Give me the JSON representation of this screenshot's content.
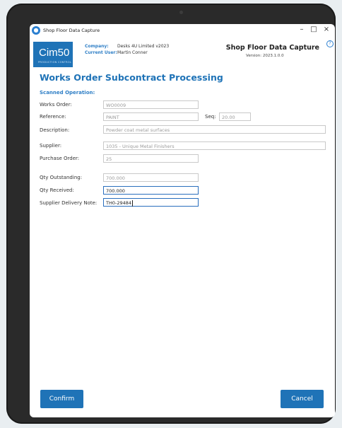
{
  "window": {
    "title": "Shop Floor Data Capture",
    "controls": {
      "minimize": "–",
      "maximize": "□",
      "close": "×"
    }
  },
  "header": {
    "logo_text": "Cim50",
    "logo_sub": "PRODUCTION CONTROL",
    "company_label": "Company:",
    "company_value": "Desks 4U Limited v2023",
    "user_label": "Current User:",
    "user_value": "Martin Conner",
    "app_title": "Shop Floor Data Capture",
    "version": "Version: 2023.1.0.0",
    "help_icon": "?"
  },
  "page": {
    "title": "Works Order Subcontract Processing",
    "section": "Scanned Operation:"
  },
  "form": {
    "works_order_label": "Works Order:",
    "works_order_value": "WO0009",
    "reference_label": "Reference:",
    "reference_value": "PAINT",
    "seq_label": "Seq:",
    "seq_value": "20.00",
    "description_label": "Description:",
    "description_value": "Powder coat metal surfaces",
    "supplier_label": "Supplier:",
    "supplier_value": "1035 - Unique Metal Finishers",
    "purchase_order_label": "Purchase Order:",
    "purchase_order_value": "25",
    "qty_outstanding_label": "Qty Outstanding:",
    "qty_outstanding_value": "700.000",
    "qty_received_label": "Qty Received:",
    "qty_received_value": "700.000",
    "delivery_note_label": "Supplier Delivery Note:",
    "delivery_note_value": "TH0-29484"
  },
  "buttons": {
    "confirm": "Confirm",
    "cancel": "Cancel"
  },
  "colors": {
    "accent": "#1f73b7",
    "label_blue": "#2f7fc6",
    "bezel": "#2a2a2a"
  }
}
